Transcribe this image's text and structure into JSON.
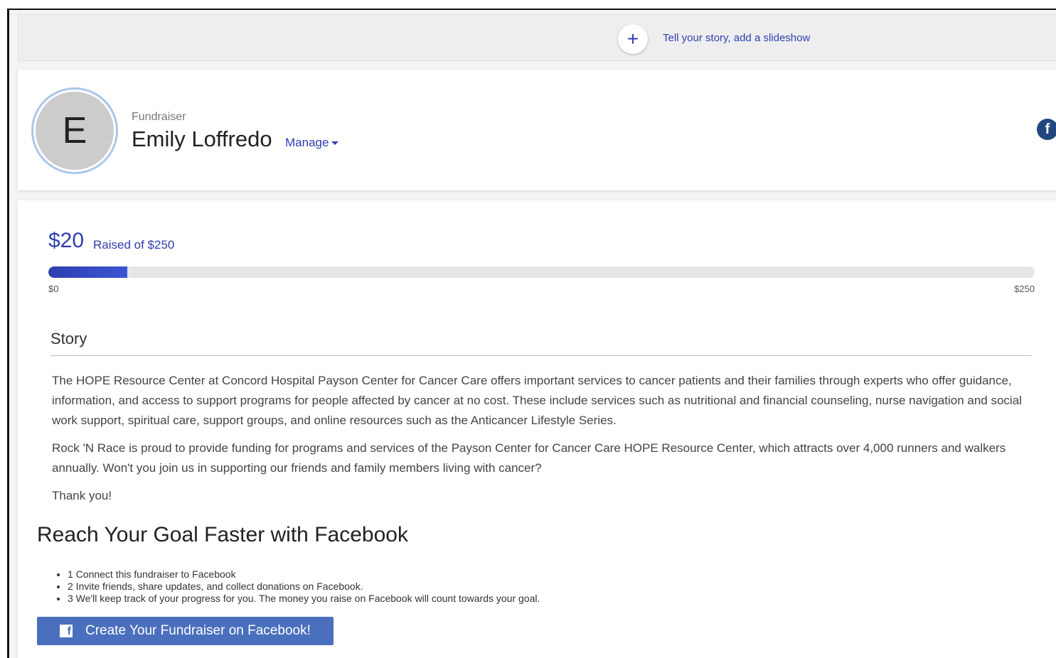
{
  "slideshow": {
    "add_icon": "+",
    "link_text": "Tell your story, add a slideshow"
  },
  "profile": {
    "avatar_initial": "E",
    "role": "Fundraiser",
    "name": "Emily Loffredo",
    "manage_label": "Manage",
    "share_icon": "facebook-icon"
  },
  "progress": {
    "raised": "$20",
    "raised_of": "Raised of $250",
    "fraction": 0.08,
    "min_label": "$0",
    "max_label": "$250",
    "color": "#2f3fae"
  },
  "story": {
    "title": "Story",
    "paragraphs": [
      "The HOPE Resource Center at Concord Hospital Payson Center for Cancer Care offers important services to cancer patients and their families through experts who offer guidance, information, and access to support programs for people affected by cancer at no cost. These include services such as nutritional and financial counseling, nurse navigation and social work support, spiritual care, support groups, and online resources such as the Anticancer Lifestyle Series.",
      "Rock 'N Race is proud to provide funding for programs and services of the Payson Center for Cancer Care HOPE Resource Center, which attracts over 4,000 runners and walkers annually. Won't you join us in supporting our friends and family members living with cancer?",
      "Thank you!"
    ]
  },
  "facebook": {
    "heading": "Reach Your Goal Faster with Facebook",
    "steps": [
      "1 Connect this fundraiser to Facebook",
      "2 Invite friends, share updates, and collect donations on Facebook.",
      "3 We'll keep track of your progress for you. The money you raise on Facebook will count towards your goal."
    ],
    "button_label": "Create Your Fundraiser on Facebook!",
    "brand_color": "#4a6fbd"
  }
}
